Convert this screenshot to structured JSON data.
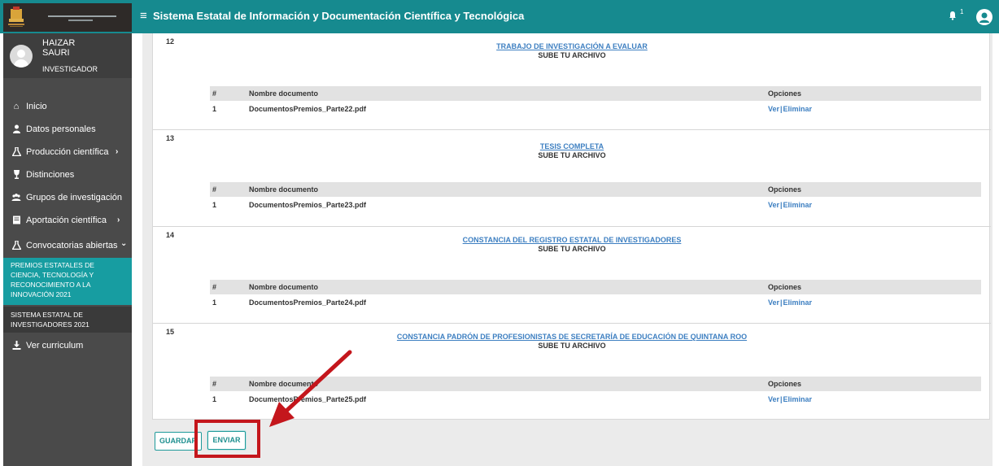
{
  "header": {
    "title": "Sistema Estatal de Información y Documentación Científica y Tecnológica",
    "menu_icon": "hamburger-icon",
    "notification_count": "1"
  },
  "profile": {
    "name_line1": "HAIZAR",
    "name_line2": "SAURI",
    "role": "INVESTIGADOR"
  },
  "sidebar": {
    "items": [
      {
        "label": "Inicio",
        "icon": "home-icon"
      },
      {
        "label": "Datos personales",
        "icon": "user-icon"
      },
      {
        "label": "Producción científica",
        "icon": "flask-icon",
        "chevron": "›"
      },
      {
        "label": "Distinciones",
        "icon": "trophy-icon"
      },
      {
        "label": "Grupos de investigación",
        "icon": "users-icon"
      },
      {
        "label": "Aportación científica",
        "icon": "book-icon",
        "chevron": "›"
      },
      {
        "label": "Convocatorias abiertas",
        "icon": "flask-icon",
        "chevron": "⌄"
      },
      {
        "label": "Ver curriculum",
        "icon": "download-icon"
      }
    ],
    "submenu": [
      "PREMIOS ESTATALES DE CIENCIA, TECNOLOGÍA Y RECONOCIMIENTO A LA INNOVACIÓN 2021",
      "SISTEMA ESTATAL DE INVESTIGADORES 2021"
    ]
  },
  "table": {
    "col_num": "#",
    "col_name": "Nombre documento",
    "col_options": "Opciones",
    "view_label": "Ver",
    "separator": "|",
    "delete_label": "Eliminar",
    "upload_label": "SUBE TU ARCHIVO"
  },
  "sections": [
    {
      "number": "12",
      "title": "TRABAJO DE INVESTIGACIÓN A EVALUAR",
      "row_num": "1",
      "file": "DocumentosPremios_Parte22.pdf"
    },
    {
      "number": "13",
      "title": "TESIS COMPLETA",
      "row_num": "1",
      "file": "DocumentosPremios_Parte23.pdf"
    },
    {
      "number": "14",
      "title": "CONSTANCIA DEL REGISTRO ESTATAL DE INVESTIGADORES",
      "row_num": "1",
      "file": "DocumentosPremios_Parte24.pdf"
    },
    {
      "number": "15",
      "title": "CONSTANCIA PADRÓN DE PROFESIONISTAS DE SECRETARÍA DE EDUCACIÓN DE QUINTANA ROO",
      "row_num": "1",
      "file": "DocumentosPremios_Parte25.pdf"
    }
  ],
  "actions": {
    "save_label": "GUARDAR",
    "send_label": "ENVIAR"
  },
  "colors": {
    "topbar": "#168a8f",
    "sidebar": "#4a4a4a",
    "active_submenu": "#179da1",
    "link": "#3d7fc1",
    "annotation": "#c4161c"
  }
}
